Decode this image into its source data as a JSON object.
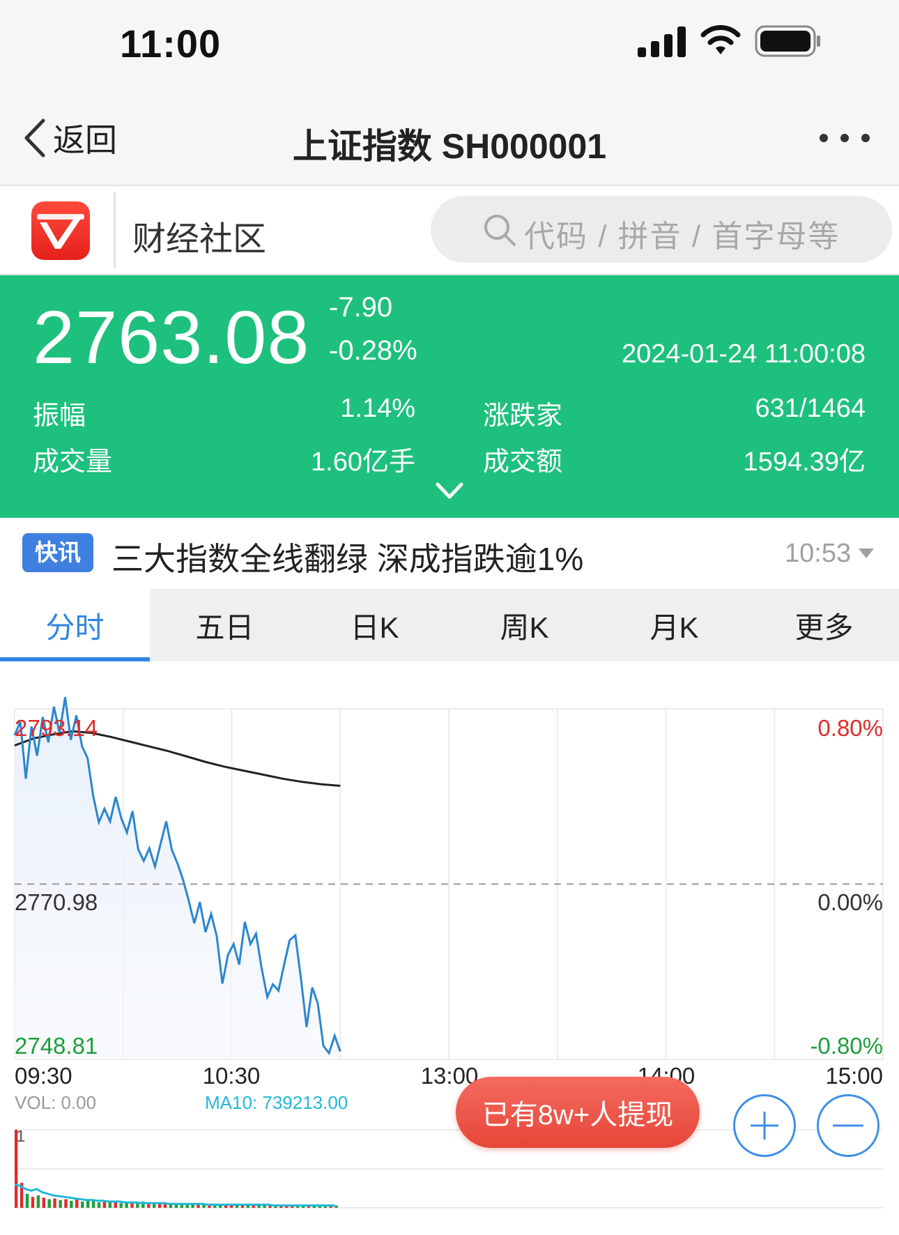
{
  "status_bar": {
    "time": "11:00",
    "icons": [
      "signal-icon",
      "wifi-icon",
      "battery-icon"
    ]
  },
  "nav": {
    "back_label": "返回",
    "title": "上证指数 SH000001",
    "more_icon": "more-icon"
  },
  "community": {
    "label": "财经社区",
    "search_placeholder": "代码 / 拼音 / 首字母等"
  },
  "quote": {
    "price": "2763.08",
    "change": "-7.90",
    "change_pct": "-0.28%",
    "datetime": "2024-01-24 11:00:08",
    "stats": [
      {
        "label": "振幅",
        "value": "1.14%"
      },
      {
        "label": "涨跌家",
        "value": "631/1464"
      },
      {
        "label": "成交量",
        "value": "1.60亿手"
      },
      {
        "label": "成交额",
        "value": "1594.39亿"
      }
    ]
  },
  "news": {
    "badge": "快讯",
    "headline": "三大指数全线翻绿 深成指跌逾1%",
    "time": "10:53"
  },
  "tabs": [
    "分时",
    "五日",
    "日K",
    "周K",
    "月K",
    "更多"
  ],
  "active_tab": 0,
  "chart_data": {
    "type": "line",
    "series": [
      {
        "values": [
          2789.8,
          2791.5,
          2784.3,
          2790.9,
          2787.2,
          2792.1,
          2788.9,
          2793.4,
          2790.1,
          2794.6,
          2789.2,
          2792.3,
          2788.4,
          2786.9,
          2782.1,
          2778.8,
          2780.5,
          2778.9,
          2782.0,
          2779.3,
          2777.5,
          2780.2,
          2775.4,
          2773.9,
          2775.5,
          2773.2,
          2776.1,
          2778.9,
          2775.3,
          2773.6,
          2771.5,
          2768.9,
          2766.0,
          2768.7,
          2764.9,
          2767.2,
          2764.4,
          2758.4,
          2762.0,
          2763.4,
          2760.8,
          2766.2,
          2763.4,
          2764.7,
          2760.3,
          2756.7,
          2758.3,
          2757.5,
          2760.8,
          2763.9,
          2764.5,
          2759.0,
          2752.9,
          2757.9,
          2755.9,
          2750.5,
          2749.6,
          2751.8,
          2749.8
        ]
      },
      {
        "values": [
          2788.5,
          2789.4,
          2789.9,
          2790.3,
          2790.1,
          2789.6,
          2789.0,
          2788.4,
          2787.8,
          2787.1,
          2786.4,
          2785.8,
          2785.3,
          2784.8,
          2784.3,
          2783.9,
          2783.6,
          2783.4
        ]
      }
    ],
    "x_ticks": [
      "09:30",
      "10:30",
      "13:00",
      "14:00",
      "15:00"
    ],
    "y_left_ticks": [
      "2793.14",
      "2770.98",
      "2748.81"
    ],
    "y_right_ticks": [
      "0.80%",
      "0.00%",
      "-0.80%"
    ],
    "ylim": [
      2748.81,
      2793.14
    ],
    "reference": 2770.98,
    "volume": {
      "label": "VOL: 0.00",
      "ma_label": "MA10: 739213.00",
      "top_tick": "1",
      "bars": [
        1.0,
        0.32,
        0.18,
        0.14,
        0.16,
        0.13,
        0.11,
        0.12,
        0.1,
        0.11,
        0.09,
        0.12,
        0.08,
        0.09,
        0.1,
        0.07,
        0.08,
        0.07,
        0.09,
        0.06,
        0.07,
        0.07,
        0.06,
        0.08,
        0.06,
        0.05,
        0.07,
        0.06,
        0.05,
        0.06,
        0.05,
        0.06,
        0.05,
        0.04,
        0.05,
        0.04,
        0.05,
        0.05,
        0.04,
        0.05,
        0.04,
        0.04,
        0.05,
        0.04,
        0.03,
        0.04,
        0.04,
        0.03,
        0.04,
        0.03,
        0.04,
        0.03,
        0.03,
        0.04,
        0.03,
        0.03,
        0.04,
        0.03,
        0.03
      ],
      "ma": [
        0.3,
        0.28,
        0.24,
        0.22,
        0.24,
        0.2,
        0.18,
        0.16,
        0.15,
        0.14,
        0.13,
        0.12,
        0.11,
        0.1,
        0.1,
        0.09,
        0.09,
        0.08,
        0.08,
        0.08,
        0.07,
        0.07,
        0.07,
        0.06,
        0.06,
        0.06,
        0.06,
        0.06,
        0.05,
        0.05,
        0.05,
        0.05,
        0.05,
        0.05,
        0.05,
        0.04,
        0.04,
        0.04,
        0.04,
        0.04,
        0.04,
        0.04,
        0.04,
        0.04,
        0.04,
        0.04,
        0.04,
        0.03,
        0.03,
        0.03,
        0.03,
        0.03,
        0.03,
        0.03,
        0.03,
        0.03,
        0.03,
        0.03,
        0.03
      ]
    },
    "colors": {
      "price": "#2a86d0",
      "avg": "#222222",
      "up": "#e02b2b",
      "down": "#1e9e3c",
      "ma": "#22b8d6"
    }
  },
  "withdraw_button": "已有8w+人提现",
  "zoom": {
    "in_icon": "plus-icon",
    "out_icon": "minus-icon"
  }
}
